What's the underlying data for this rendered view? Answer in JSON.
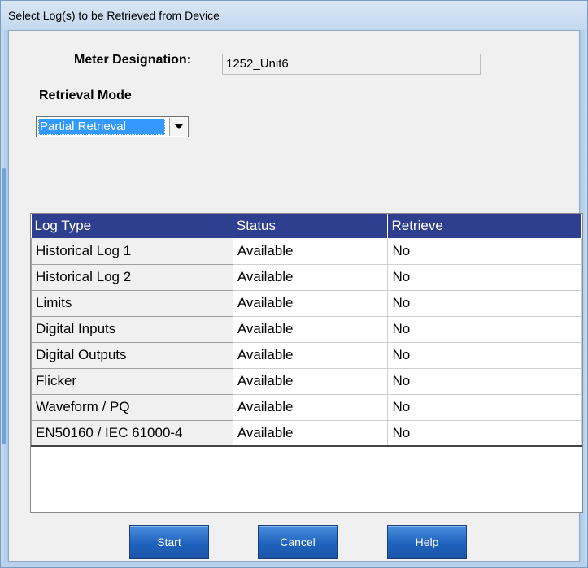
{
  "window": {
    "title": "Select Log(s) to be Retrieved from Device"
  },
  "meter": {
    "label": "Meter Designation:",
    "value": "1252_Unit6"
  },
  "retrieval": {
    "label": "Retrieval Mode",
    "selected": "Partial Retrieval"
  },
  "table": {
    "headers": [
      "Log Type",
      "Status",
      "Retrieve"
    ],
    "rows": [
      [
        "Historical Log 1",
        "Available",
        "No"
      ],
      [
        "Historical Log 2",
        "Available",
        "No"
      ],
      [
        "Limits",
        "Available",
        "No"
      ],
      [
        "Digital Inputs",
        "Available",
        "No"
      ],
      [
        "Digital Outputs",
        "Available",
        "No"
      ],
      [
        "Flicker",
        "Available",
        "No"
      ],
      [
        "Waveform / PQ",
        "Available",
        "No"
      ],
      [
        "EN50160 / IEC 61000-4",
        "Available",
        "No"
      ]
    ]
  },
  "buttons": {
    "start": "Start",
    "cancel": "Cancel",
    "help": "Help"
  },
  "icons": {
    "dropdown": "chevron-down-icon"
  },
  "colors": {
    "header_bg": "#2e3f8f",
    "selection": "#3399ff",
    "button": "#1f63be"
  }
}
